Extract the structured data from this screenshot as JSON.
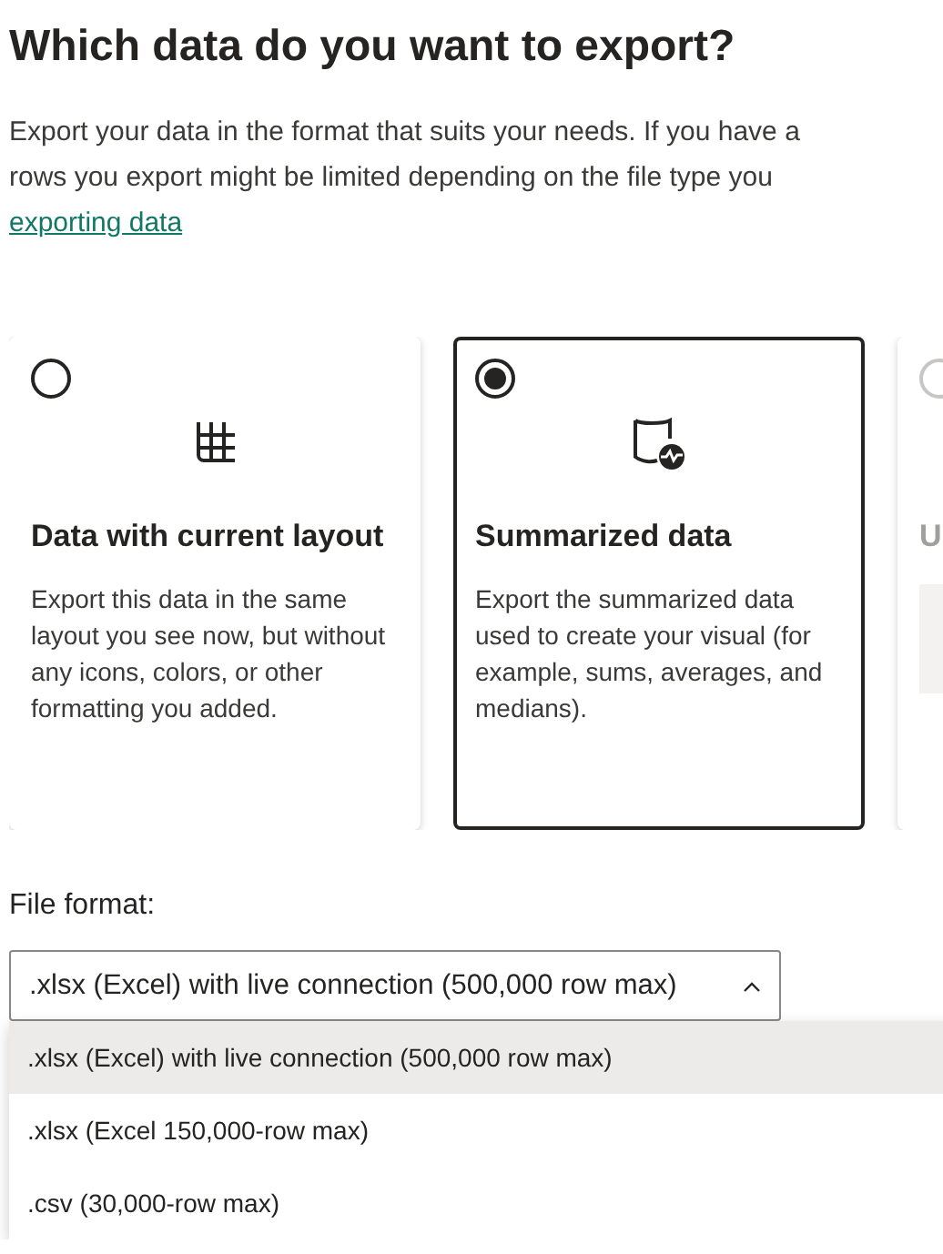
{
  "title": "Which data do you want to export?",
  "intro_lines": [
    "Export your data in the format that suits your needs. If you have a",
    "rows you export might be limited depending on the file type you"
  ],
  "link": "exporting data",
  "options": [
    {
      "kind": "table",
      "title": "Data with current layout",
      "description": "Export this data in the same layout you see now, but without any icons, colors, or other formatting you added.",
      "selected": false,
      "disabled": false
    },
    {
      "kind": "summary",
      "title": "Summarized data",
      "description": "Export the summarized data used to create your visual (for example, sums, averages, and medians).",
      "selected": true,
      "disabled": false
    },
    {
      "kind": "blank",
      "title": "U",
      "selected": false,
      "disabled": true
    }
  ],
  "file_format": {
    "label": "File format:",
    "value": ".xlsx (Excel) with live connection (500,000 row max)",
    "expanded": true,
    "options": [
      {
        "label": ".xlsx (Excel) with live connection (500,000 row max)",
        "selected": true
      },
      {
        "label": ".xlsx (Excel 150,000-row max)",
        "selected": false
      },
      {
        "label": ".csv (30,000-row max)",
        "selected": false
      }
    ]
  }
}
